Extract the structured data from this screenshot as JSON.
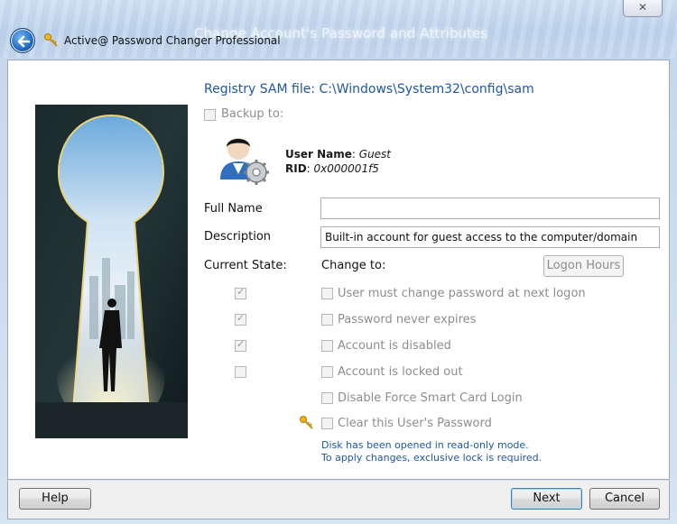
{
  "window": {
    "caption": "Change Account's Password and Attributes",
    "close_glyph": "✕",
    "app_title": "Active@ Password Changer Professional"
  },
  "main": {
    "sam_path": "Registry SAM file: C:\\Windows\\System32\\config\\sam",
    "backup_label": "Backup to:",
    "user_name_label": "User Name",
    "user_name_value": "Guest",
    "rid_label": "RID",
    "rid_value": "0x000001f5",
    "full_name_label": "Full Name",
    "full_name_value": "",
    "description_label": "Description",
    "description_value": "Built-in account for guest access to the computer/domain",
    "current_state_label": "Current State:",
    "change_to_label": "Change to:",
    "logon_hours_label": "Logon Hours",
    "options": [
      {
        "label": "User must change password at next logon",
        "current": true
      },
      {
        "label": "Password never expires",
        "current": true
      },
      {
        "label": "Account is disabled",
        "current": true
      },
      {
        "label": "Account is locked out",
        "current": false
      },
      {
        "label": "Disable Force Smart Card Login"
      },
      {
        "label": "Clear this User's Password"
      }
    ],
    "note_line1": "Disk has been opened in read-only mode.",
    "note_line2": "To apply changes, exclusive lock is required."
  },
  "footer": {
    "help_label": "Help",
    "next_label": "Next",
    "cancel_label": "Cancel"
  },
  "colors": {
    "accent_text": "#1e56a8",
    "disabled_text": "#8d8d8d",
    "back_button": "#1f69c4"
  },
  "icons": {
    "back": "back-arrow-icon",
    "app": "keys-icon",
    "user": "user-gear-icon",
    "clear_password": "keys-icon"
  }
}
